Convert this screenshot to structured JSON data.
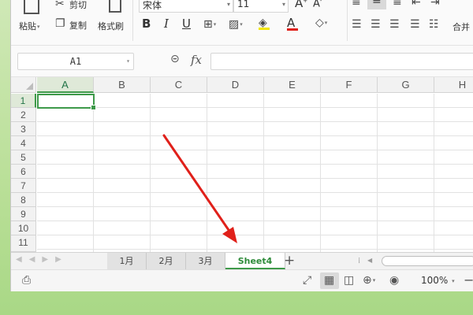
{
  "ribbon": {
    "paste_label": "粘贴",
    "cut_label": "剪切",
    "copy_label": "复制",
    "format_painter_label": "格式刷",
    "font_name": "宋体",
    "font_size": "11",
    "bold": "B",
    "italic": "I",
    "underline": "U",
    "font_color_glyph": "A",
    "merge_label": "合并"
  },
  "formula_bar": {
    "name_box": "A1",
    "fx_label": "fx",
    "formula": ""
  },
  "grid": {
    "columns": [
      "A",
      "B",
      "C",
      "D",
      "E",
      "F",
      "G",
      "H"
    ],
    "rows": [
      "1",
      "2",
      "3",
      "4",
      "5",
      "6",
      "7",
      "8",
      "9",
      "10",
      "11"
    ],
    "active_cell": "A1"
  },
  "sheets": {
    "tabs": [
      "1月",
      "2月",
      "3月",
      "Sheet4"
    ],
    "active": "Sheet4",
    "add_label": "+"
  },
  "status": {
    "zoom": "100%"
  },
  "colors": {
    "accent": "#3e9a4a",
    "arrow": "#e0201a",
    "background": "#bfe0a0"
  }
}
